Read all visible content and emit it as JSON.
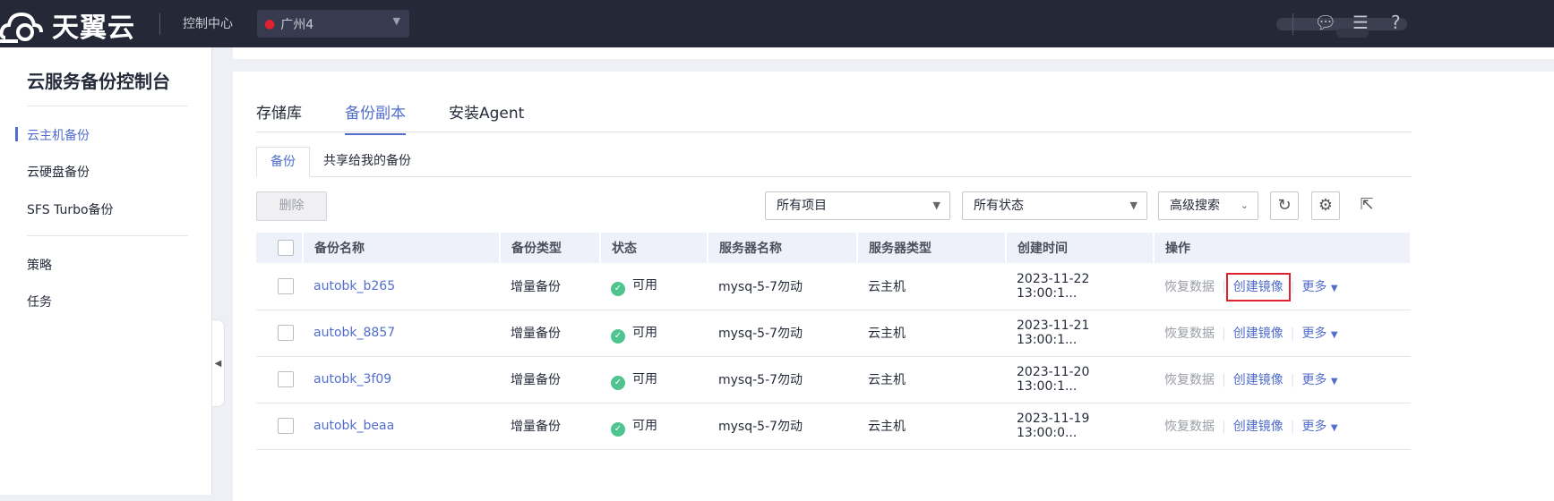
{
  "header": {
    "brand": "天翼云",
    "control_center": "控制中心",
    "region": "广州4"
  },
  "sidebar": {
    "title": "云服务备份控制台",
    "items": [
      {
        "label": "云主机备份"
      },
      {
        "label": "云硬盘备份"
      },
      {
        "label": "SFS Turbo备份"
      },
      {
        "label": "策略"
      },
      {
        "label": "任务"
      }
    ]
  },
  "tabs": [
    {
      "label": "存储库"
    },
    {
      "label": "备份副本"
    },
    {
      "label": "安装Agent"
    }
  ],
  "subtabs": [
    {
      "label": "备份"
    },
    {
      "label": "共享给我的备份"
    }
  ],
  "toolbar": {
    "delete": "删除",
    "project": "所有项目",
    "status": "所有状态",
    "advanced": "高级搜索"
  },
  "table": {
    "headers": [
      "备份名称",
      "备份类型",
      "状态",
      "服务器名称",
      "服务器类型",
      "创建时间",
      "操作"
    ],
    "rows": [
      {
        "name": "autobk_b265",
        "type": "增量备份",
        "status": "可用",
        "server": "mysq-5-7勿动",
        "server_type": "云主机",
        "time": "2023-11-22 13:00:1..."
      },
      {
        "name": "autobk_8857",
        "type": "增量备份",
        "status": "可用",
        "server": "mysq-5-7勿动",
        "server_type": "云主机",
        "time": "2023-11-21 13:00:1..."
      },
      {
        "name": "autobk_3f09",
        "type": "增量备份",
        "status": "可用",
        "server": "mysq-5-7勿动",
        "server_type": "云主机",
        "time": "2023-11-20 13:00:1..."
      },
      {
        "name": "autobk_beaa",
        "type": "增量备份",
        "status": "可用",
        "server": "mysq-5-7勿动",
        "server_type": "云主机",
        "time": "2023-11-19 13:00:0..."
      }
    ],
    "actions": {
      "restore": "恢复数据",
      "image": "创建镜像",
      "more": "更多"
    }
  }
}
